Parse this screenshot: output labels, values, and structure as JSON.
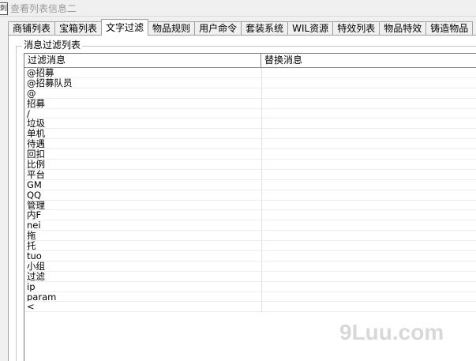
{
  "window": {
    "icon_name": "app-icon",
    "icon_text": "刺",
    "title": "查看列表信息二"
  },
  "tabs": [
    {
      "label": "商铺列表",
      "active": false
    },
    {
      "label": "宝箱列表",
      "active": false
    },
    {
      "label": "文字过滤",
      "active": true
    },
    {
      "label": "物品规则",
      "active": false
    },
    {
      "label": "用户命令",
      "active": false
    },
    {
      "label": "套装系统",
      "active": false
    },
    {
      "label": "WIL资源",
      "active": false
    },
    {
      "label": "特效列表",
      "active": false
    },
    {
      "label": "物品特效",
      "active": false
    },
    {
      "label": "铸造物品",
      "active": false
    }
  ],
  "filter_group": {
    "label": "消息过滤列表",
    "columns": [
      "过滤消息",
      "替换消息"
    ],
    "rows": [
      {
        "filter": "@招募",
        "replace": ""
      },
      {
        "filter": "@招募队员",
        "replace": ""
      },
      {
        "filter": "@",
        "replace": ""
      },
      {
        "filter": "招募",
        "replace": ""
      },
      {
        "filter": "/",
        "replace": ""
      },
      {
        "filter": "垃圾",
        "replace": ""
      },
      {
        "filter": "单机",
        "replace": ""
      },
      {
        "filter": "待遇",
        "replace": ""
      },
      {
        "filter": "回扣",
        "replace": ""
      },
      {
        "filter": "比例",
        "replace": ""
      },
      {
        "filter": "平台",
        "replace": ""
      },
      {
        "filter": "GM",
        "replace": ""
      },
      {
        "filter": "QQ",
        "replace": ""
      },
      {
        "filter": "管理",
        "replace": ""
      },
      {
        "filter": "内F",
        "replace": ""
      },
      {
        "filter": "nei",
        "replace": ""
      },
      {
        "filter": "拖",
        "replace": ""
      },
      {
        "filter": "托",
        "replace": ""
      },
      {
        "filter": "tuo",
        "replace": ""
      },
      {
        "filter": "小组",
        "replace": ""
      },
      {
        "filter": "过滤",
        "replace": ""
      },
      {
        "filter": "ip",
        "replace": ""
      },
      {
        "filter": "param",
        "replace": ""
      },
      {
        "filter": "<",
        "replace": ""
      }
    ]
  },
  "watermark": "9Luu.com",
  "colors": {
    "background": "#f0f0f0",
    "panel": "#ffffff",
    "border": "#a0a0a0",
    "watermark": "#d8d8d8"
  }
}
